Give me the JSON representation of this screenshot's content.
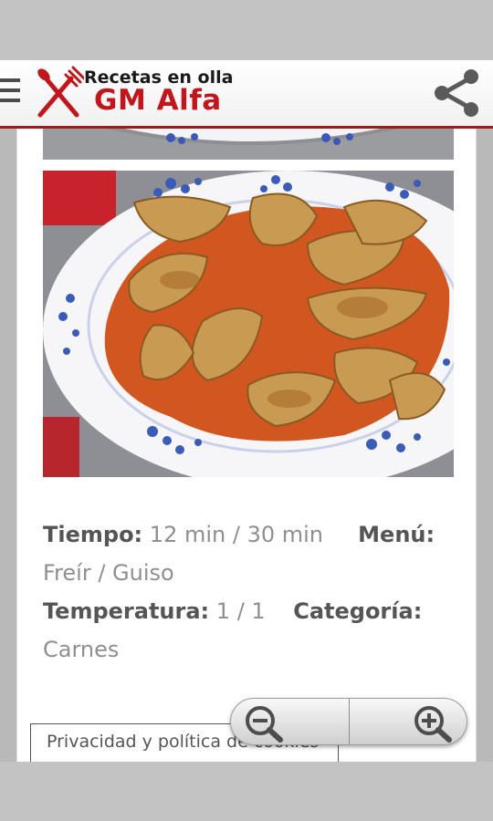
{
  "header": {
    "logo_line1": "Recetas en olla",
    "logo_line2": "GM Alfa"
  },
  "recipe": {
    "tiempo_label": "Tiempo:",
    "tiempo_value": "12 min / 30 min",
    "menu_label": "Menú:",
    "menu_value": "Freír / Guiso",
    "temperatura_label": "Temperatura:",
    "temperatura_value": "1 / 1",
    "categoria_label": "Categoría:",
    "categoria_value": "Carnes"
  },
  "footer": {
    "privacy_link": "Privacidad y política de cookies"
  },
  "colors": {
    "brand_red": "#c0161c",
    "header_border": "#9a1d1d"
  },
  "icons": {
    "menu": "menu-icon",
    "logo": "fork-knife-icon",
    "share": "share-icon",
    "zoom_out": "zoom-out-icon",
    "zoom_in": "zoom-in-icon"
  }
}
